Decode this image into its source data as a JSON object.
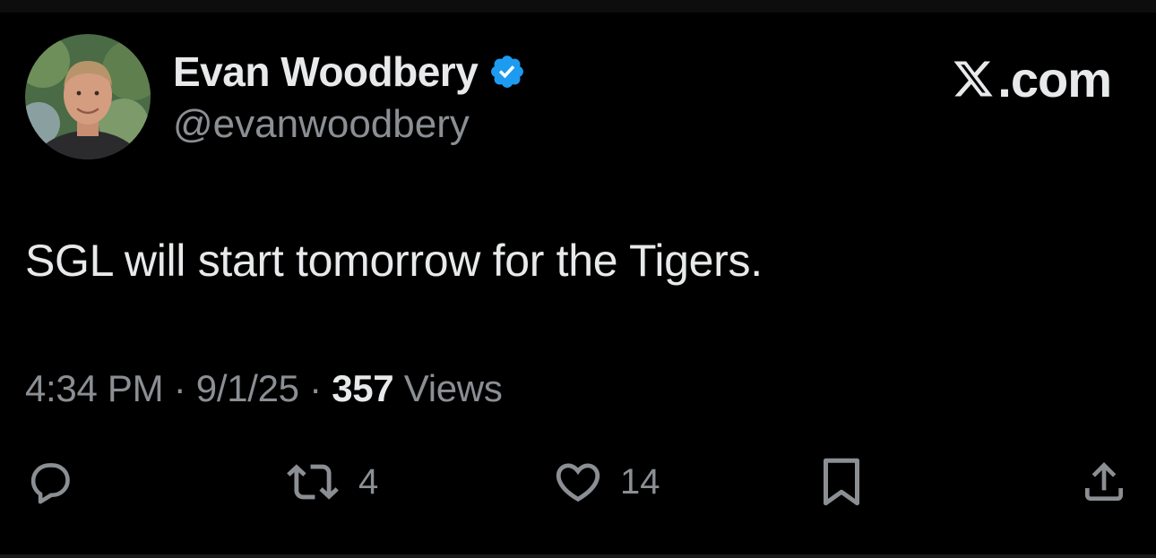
{
  "author": {
    "display_name": "Evan Woodbery",
    "handle": "@evanwoodbery",
    "verified": true,
    "verified_badge_color": "#1d9bf0"
  },
  "brand": {
    "text": ".com",
    "icon": "x-logo-icon"
  },
  "tweet": {
    "text": "SGL will start tomorrow for the Tigers."
  },
  "meta": {
    "time": "4:34 PM",
    "separator": "·",
    "date": "9/1/25",
    "views_count": "357",
    "views_label": "Views"
  },
  "actions": {
    "reply": {
      "icon": "reply-icon"
    },
    "retweet": {
      "icon": "retweet-icon",
      "count": "4"
    },
    "like": {
      "icon": "heart-icon",
      "count": "14"
    },
    "bookmark": {
      "icon": "bookmark-icon"
    },
    "share": {
      "icon": "share-icon"
    }
  },
  "colors": {
    "background": "#000000",
    "primary_text": "#e7e9ea",
    "secondary_text": "#8b8f94",
    "accent": "#1d9bf0"
  }
}
